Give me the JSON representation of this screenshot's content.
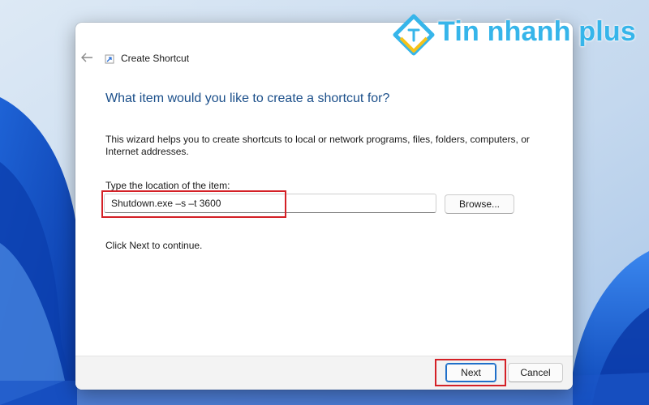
{
  "dialog": {
    "title": "Create Shortcut",
    "heading": "What item would you like to create a shortcut for?",
    "description": "This wizard helps you to create shortcuts to local or network programs, files, folders, computers, or Internet addresses.",
    "location_label": "Type the location of the item:",
    "location_value": "Shutdown.exe –s –t 3600",
    "browse_label": "Browse...",
    "continue_text": "Click Next to continue.",
    "next_label": "Next",
    "cancel_label": "Cancel"
  },
  "watermark": {
    "text": "Tin nhanh plus"
  },
  "colors": {
    "heading": "#1b4f8a",
    "highlight": "#d42026",
    "accent": "#1f6fc9",
    "watermark": "#36b5ea"
  },
  "icons": {
    "back": "back-arrow-icon",
    "shortcut": "shortcut-icon"
  }
}
